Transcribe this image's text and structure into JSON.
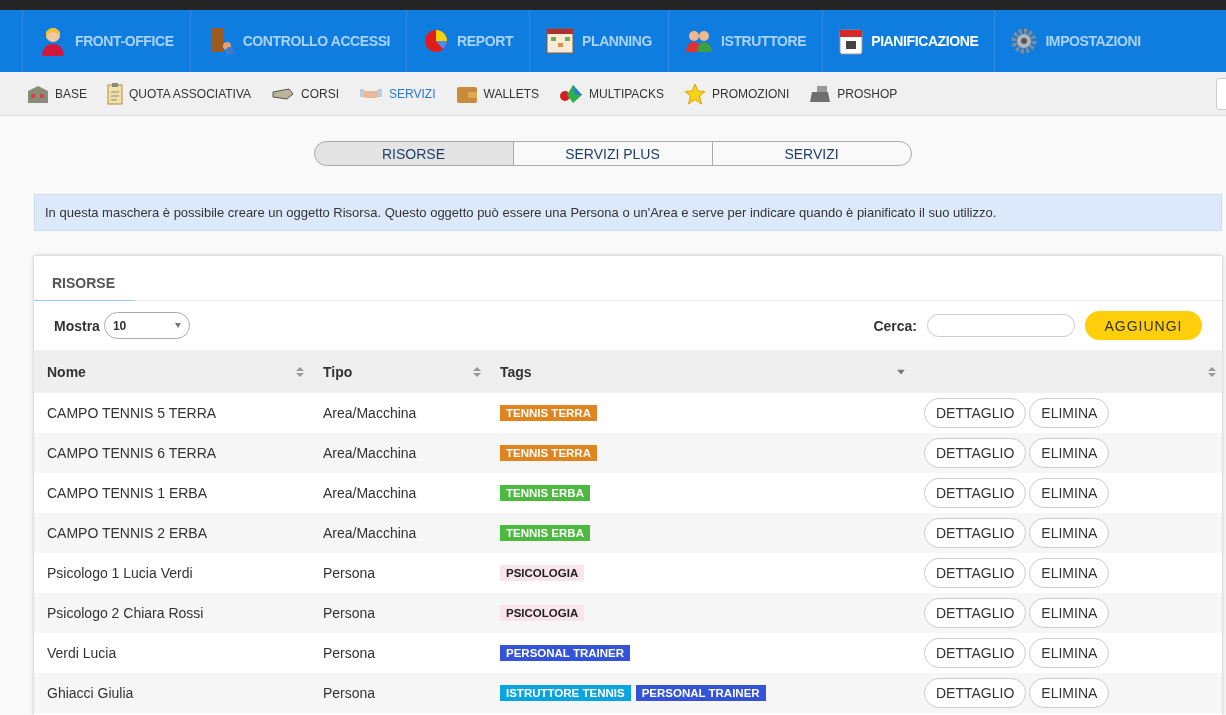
{
  "main_nav": [
    {
      "label": "FRONT-OFFICE",
      "selected": false
    },
    {
      "label": "CONTROLLO ACCESSI",
      "selected": false
    },
    {
      "label": "REPORT",
      "selected": false
    },
    {
      "label": "PLANNING",
      "selected": false
    },
    {
      "label": "ISTRUTTORE",
      "selected": false
    },
    {
      "label": "PIANIFICAZIONE",
      "selected": true
    },
    {
      "label": "IMPOSTAZIONI",
      "selected": false
    }
  ],
  "sub_nav": [
    {
      "label": "BASE",
      "selected": false
    },
    {
      "label": "QUOTA ASSOCIATIVA",
      "selected": false
    },
    {
      "label": "CORSI",
      "selected": false
    },
    {
      "label": "SERVIZI",
      "selected": true
    },
    {
      "label": "WALLETS",
      "selected": false
    },
    {
      "label": "MULTIPACKS",
      "selected": false
    },
    {
      "label": "PROMOZIONI",
      "selected": false
    },
    {
      "label": "PROSHOP",
      "selected": false
    }
  ],
  "segments": [
    {
      "label": "RISORSE",
      "selected": true
    },
    {
      "label": "SERVIZI PLUS",
      "selected": false
    },
    {
      "label": "SERVIZI",
      "selected": false
    }
  ],
  "info": "In questa maschera è possibile creare un oggetto Risorsa. Questo oggetto può essere una Persona o un'Area e serve per indicare quando è pianificato il suo utilizzo.",
  "card": {
    "tab": "RISORSE",
    "show_label": "Mostra",
    "page_size": "10",
    "search_label": "Cerca:",
    "add_button": "AGGIUNGI",
    "table": {
      "columns": [
        "Nome",
        "Tipo",
        "Tags"
      ],
      "rows": [
        {
          "name": "CAMPO TENNIS 5 TERRA",
          "type": "Area/Macchina",
          "tags": [
            {
              "label": "TENNIS TERRA",
              "color": "#e0841f"
            }
          ],
          "actions": [
            "DETTAGLIO",
            "ELIMINA"
          ]
        },
        {
          "name": "CAMPO TENNIS 6 TERRA",
          "type": "Area/Macchina",
          "tags": [
            {
              "label": "TENNIS TERRA",
              "color": "#e0841f"
            }
          ],
          "actions": [
            "DETTAGLIO",
            "ELIMINA"
          ]
        },
        {
          "name": "CAMPO TENNIS 1 ERBA",
          "type": "Area/Macchina",
          "tags": [
            {
              "label": "TENNIS ERBA",
              "color": "#4bba3f"
            }
          ],
          "actions": [
            "DETTAGLIO",
            "ELIMINA"
          ]
        },
        {
          "name": "CAMPO TENNIS 2 ERBA",
          "type": "Area/Macchina",
          "tags": [
            {
              "label": "TENNIS ERBA",
              "color": "#4bba3f"
            }
          ],
          "actions": [
            "DETTAGLIO",
            "ELIMINA"
          ]
        },
        {
          "name": "Psicologo 1 Lucia Verdi",
          "type": "Persona",
          "tags": [
            {
              "label": "PSICOLOGIA",
              "color": "#f8e4ea"
            }
          ],
          "actions": [
            "DETTAGLIO",
            "ELIMINA"
          ]
        },
        {
          "name": "Psicologo 2 Chiara Rossi",
          "type": "Persona",
          "tags": [
            {
              "label": "PSICOLOGIA",
              "color": "#f8e4ea"
            }
          ],
          "actions": [
            "DETTAGLIO",
            "ELIMINA"
          ]
        },
        {
          "name": "Verdi Lucia",
          "type": "Persona",
          "tags": [
            {
              "label": "PERSONAL TRAINER",
              "color": "#3453d6"
            }
          ],
          "actions": [
            "DETTAGLIO",
            "ELIMINA"
          ]
        },
        {
          "name": "Ghiacci Giulia",
          "type": "Persona",
          "tags": [
            {
              "label": "ISTRUTTORE TENNIS",
              "color": "#0aa4e0"
            },
            {
              "label": "PERSONAL TRAINER",
              "color": "#3453d6"
            }
          ],
          "actions": [
            "DETTAGLIO",
            "ELIMINA"
          ]
        }
      ]
    }
  }
}
